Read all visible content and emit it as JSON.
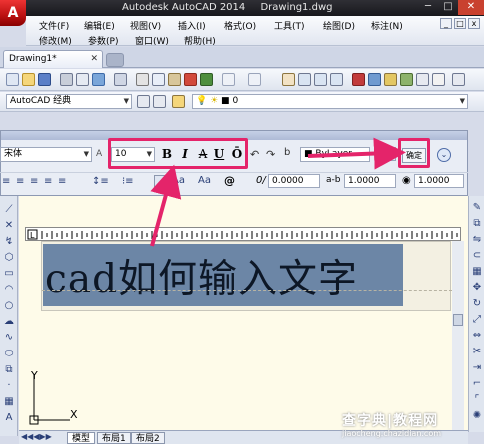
{
  "window": {
    "app_title": "Autodesk AutoCAD 2014",
    "file_title": "Drawing1.dwg",
    "minimize": "─",
    "maximize": "□",
    "close": "✕"
  },
  "menus": {
    "row1": [
      "文件(F)",
      "编辑(E)",
      "视图(V)",
      "插入(I)",
      "格式(O)",
      "工具(T)",
      "绘图(D)",
      "标注(N)"
    ],
    "row2": [
      "修改(M)",
      "参数(P)",
      "窗口(W)",
      "帮助(H)"
    ]
  },
  "tabs": {
    "doc_tab": "Drawing1*",
    "close_glyph": "✕"
  },
  "toolbar": {
    "workspace": "AutoCAD 经典",
    "layer_value": "0"
  },
  "text_format": {
    "font": "宋体",
    "height": "10",
    "bold": "B",
    "italic": "I",
    "strikethrough": "A",
    "underline": "U",
    "overline": "Ō",
    "color": "ByLayer",
    "ok_label": "确定",
    "symbol_label": "@",
    "oblique_value": "0.0000",
    "tracking_value": "1.0000",
    "width_value": "1.0000"
  },
  "drawing": {
    "mtext_content": "cad如何输入文字",
    "ucs_x": "X",
    "ucs_y": "Y"
  },
  "bottom_tabs": [
    "模型",
    "布局1",
    "布局2"
  ],
  "watermark": {
    "main": "查字典|教程网",
    "sub": "jiaocheng.chazidian.com"
  },
  "colors": {
    "highlight": "#e4246a",
    "selection": "#6c86a6",
    "canvas": "#fefbe9"
  }
}
